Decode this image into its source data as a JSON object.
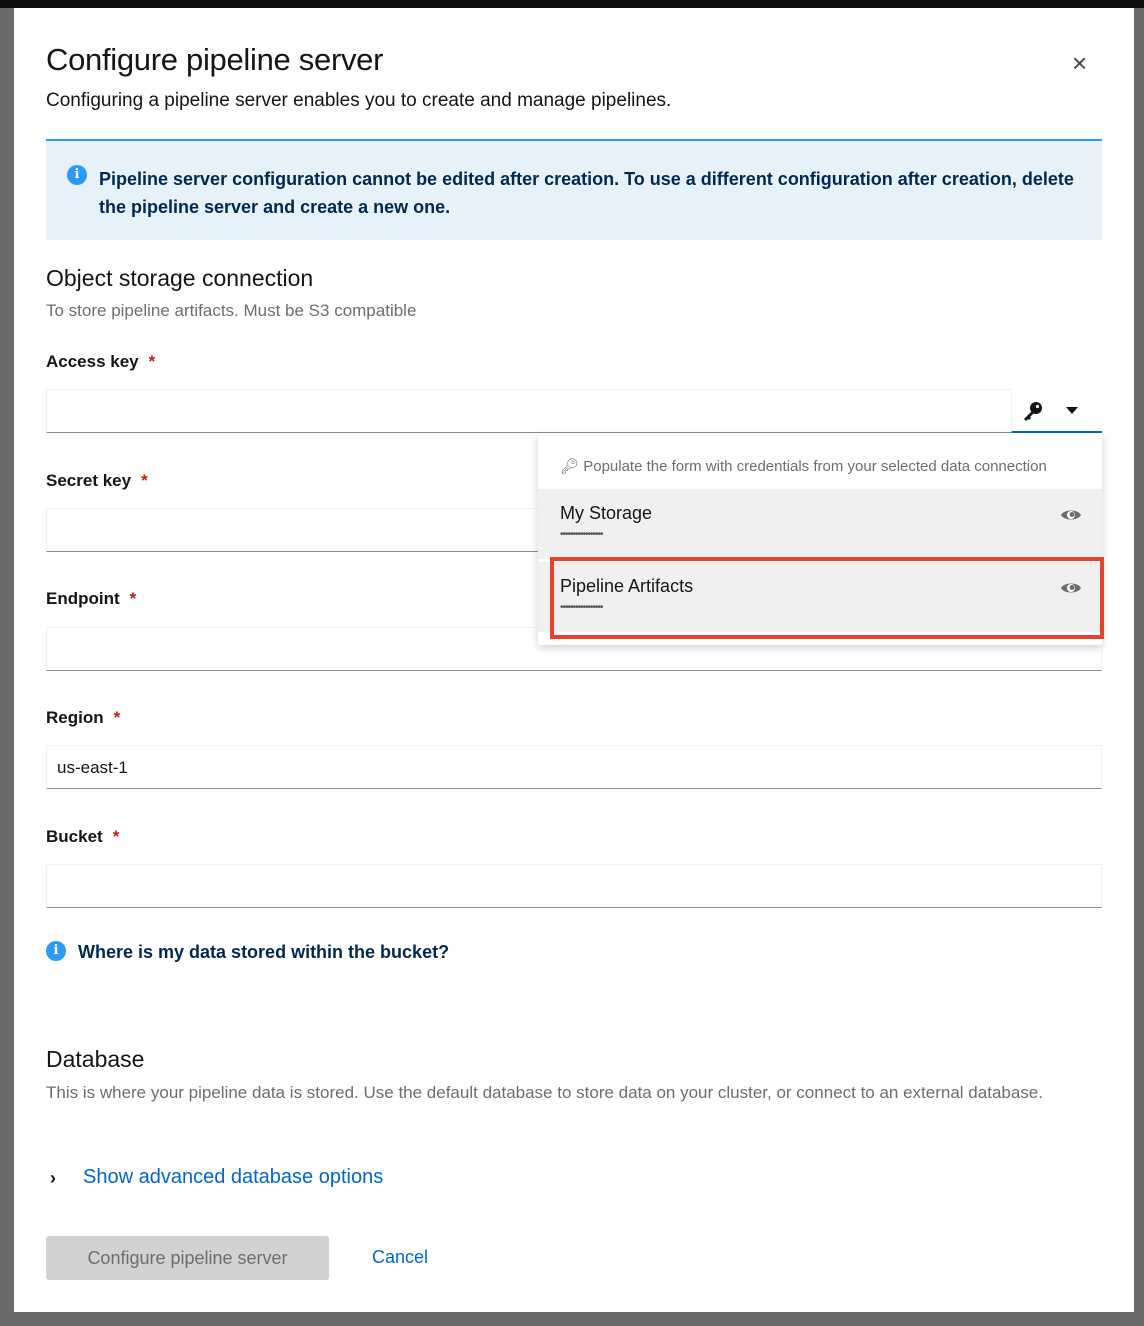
{
  "modal": {
    "title": "Configure pipeline server",
    "subtitle": "Configuring a pipeline server enables you to create and manage pipelines.",
    "close": "×"
  },
  "alert": {
    "text": "Pipeline server configuration cannot be edited after creation. To use a different configuration after creation, delete the pipeline server and create a new one.",
    "icon": "info-icon"
  },
  "storage": {
    "title": "Object storage connection",
    "description": "To store pipeline artifacts. Must be S3 compatible",
    "fields": [
      {
        "label": "Access key",
        "value": ""
      },
      {
        "label": "Secret key",
        "value": ""
      },
      {
        "label": "Endpoint",
        "value": ""
      },
      {
        "label": "Region",
        "value": "us-east-1"
      },
      {
        "label": "Bucket",
        "value": ""
      }
    ],
    "required_mark": "*",
    "help_link": "Where is my data stored within the bucket?"
  },
  "dropdown": {
    "hint": "Populate the form with credentials from your selected data connection",
    "items": [
      {
        "name": "My Storage",
        "secret": "•••••••••••••••••"
      },
      {
        "name": "Pipeline Artifacts",
        "secret": "•••••••••••••••••"
      }
    ],
    "highlighted": "Pipeline Artifacts",
    "highlight_color": "#e8412c"
  },
  "database": {
    "title": "Database",
    "description": "This is where your pipeline data is stored. Use the default database to store data on your cluster, or connect to an external database.",
    "advanced_toggle": "Show advanced database options"
  },
  "footer": {
    "submit": "Configure pipeline server",
    "cancel": "Cancel"
  }
}
